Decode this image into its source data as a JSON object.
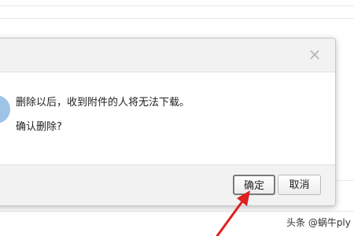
{
  "dialog": {
    "close_symbol": "×",
    "message_line1": "删除以后，收到附件的人将无法下载。",
    "message_line2": "确认删除?",
    "confirm_label": "确定",
    "cancel_label": "取消"
  },
  "icons": {
    "close": "close-icon",
    "info": "info-icon",
    "annotation": "red-arrow"
  },
  "colors": {
    "arrow": "#e02020",
    "header_bg": "#f2f2f2",
    "info_icon": "#9ec3e6"
  },
  "watermark": {
    "text": "头条 @蜗牛ply"
  }
}
